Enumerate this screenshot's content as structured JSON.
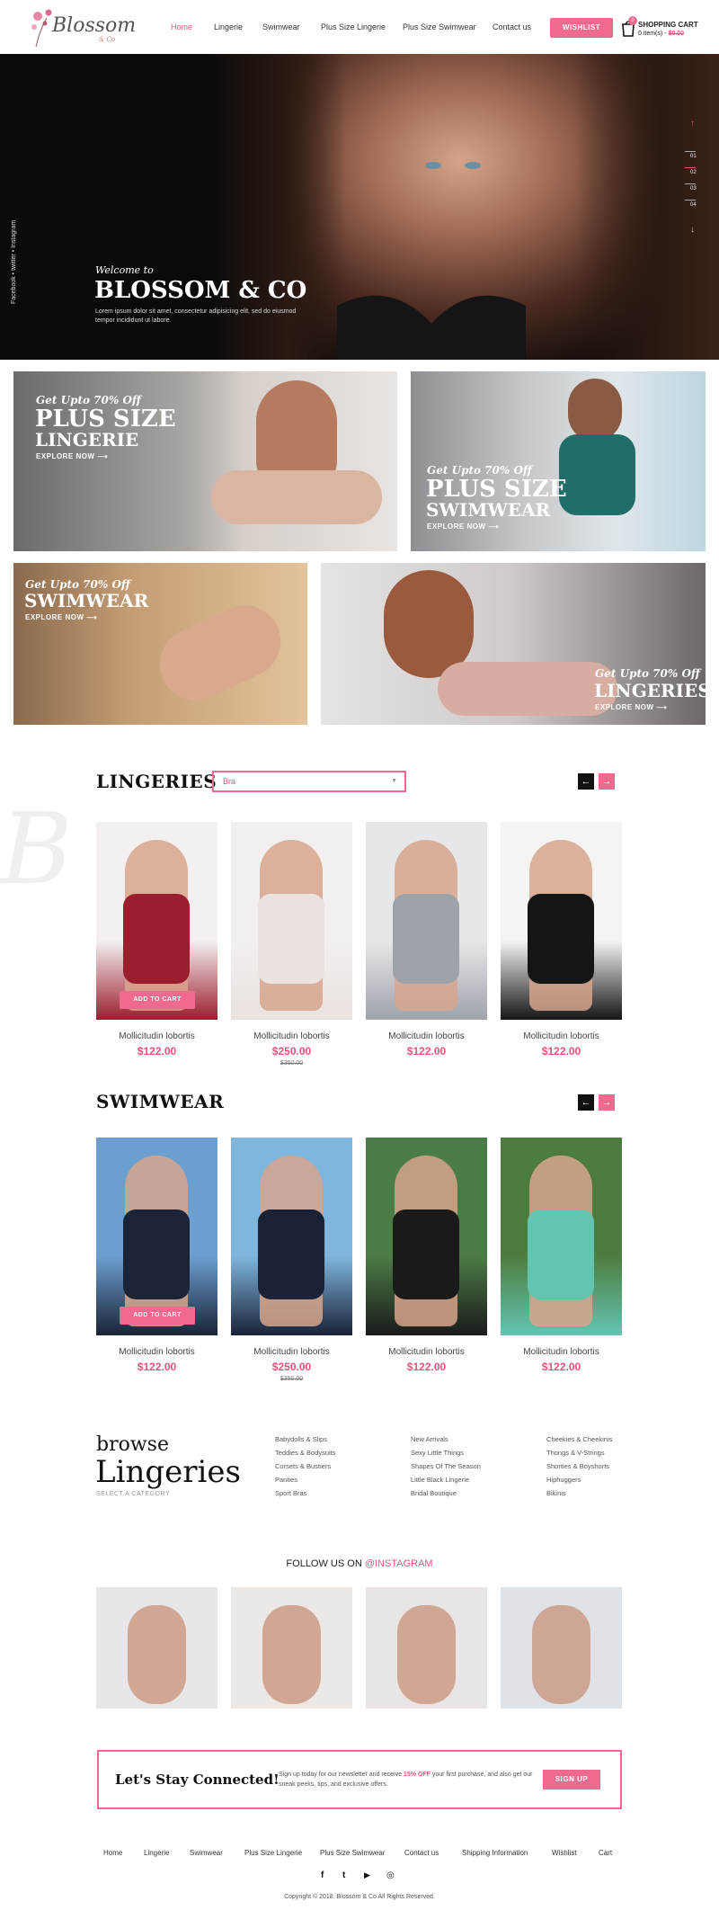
{
  "header": {
    "logo_text": "Blossom",
    "logo_sub": "& Co",
    "nav": [
      "Home",
      "Lingerie",
      "Swimwear",
      "Plus Size Lingerie",
      "Plus Size Swimwear",
      "Contact us"
    ],
    "wishlist": "WISHLIST",
    "cart_title": "SHOPPING CART",
    "cart_count": "0",
    "cart_items": "0 item(s) - ",
    "cart_total": "$0.00"
  },
  "hero": {
    "welcome": "Welcome to",
    "title": "BLOSSOM & CO",
    "text": "Lorem ipsum dolor sit amet, consectetur adipisicing elit, sed do eiusmod tempor incididunt ut labore.",
    "social": "Facebook  •  twitter  •  Instagram",
    "slides": [
      "01",
      "02",
      "03",
      "04"
    ]
  },
  "banners": [
    {
      "kicker": "Get Upto 70% Off",
      "title1": "PLUS SIZE",
      "title2": "LINGERIE",
      "cta": "EXPLORE NOW"
    },
    {
      "kicker": "Get Upto 70% Off",
      "title1": "PLUS SIZE",
      "title2": "SWIMWEAR",
      "cta": "EXPLORE NOW"
    },
    {
      "kicker": "Get Upto 70% Off",
      "title1": "SWIMWEAR",
      "cta": "EXPLORE NOW"
    },
    {
      "kicker": "Get Upto 70% Off",
      "title1": "LINGERIES",
      "cta": "EXPLORE NOW"
    }
  ],
  "lingeries": {
    "title": "LINGERIES",
    "select_value": "Bra",
    "products": [
      {
        "name": "Mollicitudin lobortis",
        "price": "$122.00",
        "old": "",
        "cart": "ADD TO CART",
        "colors": [
          "#f4f0f0",
          "#9b1e2e"
        ]
      },
      {
        "name": "Mollicitudin lobortis",
        "price": "$250.00",
        "old": "$350.00",
        "cart": "",
        "colors": [
          "#f3efee",
          "#e9e2de"
        ]
      },
      {
        "name": "Mollicitudin lobortis",
        "price": "$122.00",
        "old": "",
        "cart": "",
        "colors": [
          "#e7e7ea",
          "#9ea3aa"
        ]
      },
      {
        "name": "Mollicitudin lobortis",
        "price": "$122.00",
        "old": "",
        "cart": "",
        "colors": [
          "#f6f4f2",
          "#151515"
        ]
      }
    ]
  },
  "swimwear": {
    "title": "SWIMWEAR",
    "products": [
      {
        "name": "Mollicitudin lobortis",
        "price": "$122.00",
        "old": "",
        "cart": "ADD TO CART",
        "colors": [
          "#6b9fd0",
          "#1b2337"
        ]
      },
      {
        "name": "Mollicitudin lobortis",
        "price": "$250.00",
        "old": "$350.00",
        "cart": "",
        "colors": [
          "#7fb6de",
          "#1a2238"
        ]
      },
      {
        "name": "Mollicitudin lobortis",
        "price": "$122.00",
        "old": "",
        "cart": "",
        "colors": [
          "#4c7c46",
          "#1a1a1a"
        ]
      },
      {
        "name": "Mollicitudin lobortis",
        "price": "$122.00",
        "old": "",
        "cart": "",
        "colors": [
          "#4d7d3e",
          "#63c4b2"
        ]
      }
    ]
  },
  "browse": {
    "small": "browse",
    "big": "Lingeries",
    "sub": "SELECT A CATEGORY",
    "col1": [
      "Babydolls & Slips",
      "Teddies & Bodysuits",
      "Corsets & Bustiers",
      "Panties",
      "Sport Bras"
    ],
    "col2": [
      "New Arrivals",
      "Sexy Little Things",
      "Shapes Of The Season",
      "Little Black Lingerie",
      "Bridal Boutique"
    ],
    "col3": [
      "Cheekies & Cheekinis",
      "Thongs & V-Strings",
      "Shorties & Boyshorts",
      "Hiphuggers",
      "Bikinis"
    ]
  },
  "instagram": {
    "label": "FOLLOW US ON ",
    "handle": "@INSTAGRAM",
    "colors": [
      "#e9e6ea",
      "#ece8e6",
      "#e8e5e4",
      "#dfe3e8"
    ]
  },
  "newsletter": {
    "title": "Let's Stay Connected!",
    "text_a": "Sign up today for our newsletter and receive ",
    "text_b": "15% OFF",
    "text_c": " your first purchase, and also get our sneak peeks, tips, and exclusive offers.",
    "button": "SIGN UP"
  },
  "footer": {
    "links": [
      "Home",
      "Lingerie",
      "Swimwear",
      "Plus Size Lingerie",
      "Plus Size Swimwear",
      "Contact us",
      "Shipping Information",
      "Wishlist",
      "Cart"
    ],
    "social": [
      "f",
      "t",
      "▶",
      "◎"
    ],
    "copyright": "Copyright © 2018. Blossom & Co All Rights Reserved."
  },
  "colors": {
    "accent": "#f06a90",
    "accent_text": "#e8547c",
    "dark": "#111111"
  }
}
